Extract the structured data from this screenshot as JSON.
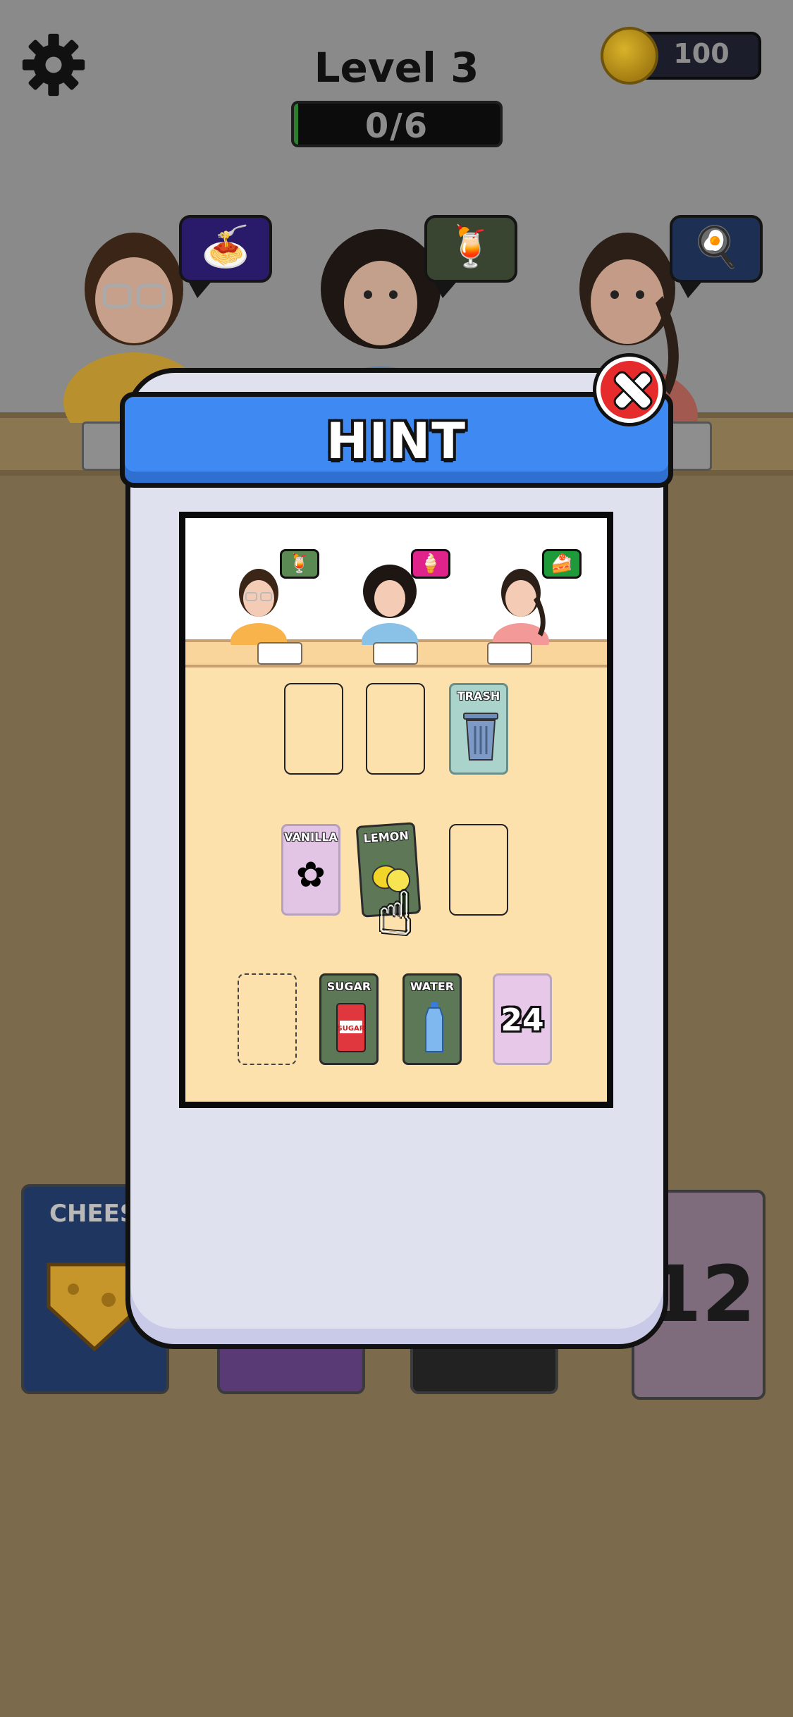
{
  "header": {
    "level_title": "Level 3",
    "progress_text": "0/6",
    "progress_fraction": 0.0,
    "coins": "100"
  },
  "customers": [
    {
      "name": "customer-glasses",
      "order_icon": "noodle-bowl-icon",
      "order_glyph": "🍝",
      "bubble_color": "#2a1b6a"
    },
    {
      "name": "customer-curly",
      "order_icon": "lemonade-icon",
      "order_glyph": "🍹",
      "bubble_color": "#3a4531"
    },
    {
      "name": "customer-ponytail",
      "order_icon": "fried-egg-icon",
      "order_glyph": "🍳",
      "bubble_color": "#1d2f52"
    }
  ],
  "background_cards": {
    "cheese_label": "CHEES",
    "deck_count": "12"
  },
  "hint_modal": {
    "title": "HINT",
    "mini_customers": [
      {
        "order_glyph": "🍹",
        "bubble_color": "#5b8b53"
      },
      {
        "order_glyph": "🍦",
        "bubble_color": "#e0238a"
      },
      {
        "order_glyph": "🍰",
        "bubble_color": "#1e9a3a"
      }
    ],
    "cards": {
      "trash": "TRASH",
      "vanilla": "VANILLA",
      "lemon": "LEMON",
      "sugar": "SUGAR",
      "water": "WATER",
      "deck_count": "24"
    }
  },
  "colors": {
    "modal_header": "#3f8af2",
    "close_button": "#e52b2b",
    "hint_background": "#fde1ad"
  }
}
